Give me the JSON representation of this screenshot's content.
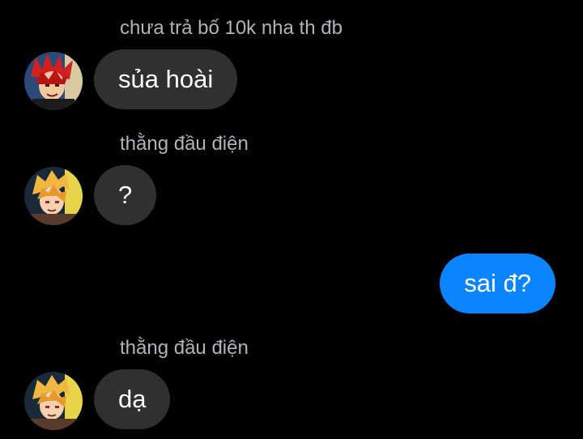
{
  "colors": {
    "background": "#000000",
    "incoming_bubble": "#303030",
    "outgoing_bubble": "#0a84ff",
    "sender_name": "#b0b3b8",
    "message_text": "#ffffff"
  },
  "messages": [
    {
      "direction": "incoming",
      "sender_name": "chưa trả bố 10k nha th đb",
      "avatar_icon": "red-spiky-hair-character-avatar",
      "text": "sủa hoài"
    },
    {
      "direction": "incoming",
      "sender_name": "thằng đầu điện",
      "avatar_icon": "blonde-character-avatar",
      "text": "?"
    },
    {
      "direction": "outgoing",
      "text": "sai đ?"
    },
    {
      "direction": "incoming",
      "sender_name": "thằng đầu điện",
      "avatar_icon": "blonde-character-avatar",
      "text": "dạ"
    }
  ]
}
